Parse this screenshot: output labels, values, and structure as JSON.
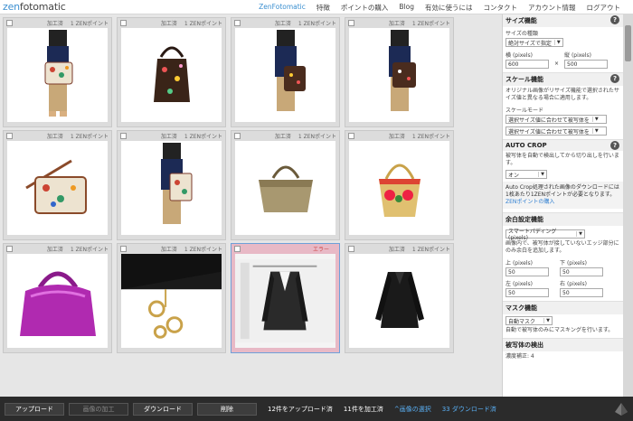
{
  "app": {
    "logo_prefix": "zen",
    "logo_suffix": "fotomatic"
  },
  "nav": [
    {
      "label": "ZenFotomatic",
      "active": true
    },
    {
      "label": "特徴",
      "active": false
    },
    {
      "label": "ポイントの購入",
      "active": false
    },
    {
      "label": "Blog",
      "active": false
    },
    {
      "label": "有効に使うには",
      "active": false
    },
    {
      "label": "コンタクト",
      "active": false
    },
    {
      "label": "アカウント情報",
      "active": false
    },
    {
      "label": "ログアウト",
      "active": false
    }
  ],
  "cards": [
    {
      "status": "加工済",
      "points": "1 ZENポイント",
      "image": "person-with-floral-bag"
    },
    {
      "status": "加工済",
      "points": "1 ZENポイント",
      "image": "dark-floral-tote"
    },
    {
      "status": "加工済",
      "points": "1 ZENポイント",
      "image": "person-with-brown-bag"
    },
    {
      "status": "加工済",
      "points": "1 ZENポイント",
      "image": "person-with-bag-back"
    },
    {
      "status": "加工済",
      "points": "1 ZENポイント",
      "image": "floral-shoulder-bag"
    },
    {
      "status": "加工済",
      "points": "1 ZENポイント",
      "image": "person-floral-tote"
    },
    {
      "status": "加工済",
      "points": "1 ZENポイント",
      "image": "khaki-tote"
    },
    {
      "status": "加工済",
      "points": "1 ZENポイント",
      "image": "straw-basket-bag"
    },
    {
      "status": "加工済",
      "points": "1 ZENポイント",
      "image": "purple-leather-bag"
    },
    {
      "status": "加工済",
      "points": "1 ZENポイント",
      "image": "bag-gold-charm"
    },
    {
      "status": "エラー",
      "points": "",
      "image": "black-suit-jacket",
      "selected": true
    },
    {
      "status": "加工済",
      "points": "1 ZENポイント",
      "image": "black-jacket"
    }
  ],
  "panel": {
    "size": {
      "title": "サイズ機能",
      "type_label": "サイズの種類",
      "type_value": "絶対サイズで指定",
      "w_label": "横",
      "h_label": "縦",
      "unit": "(pixels)",
      "w_value": "600",
      "h_value": "500",
      "x": "×"
    },
    "scale": {
      "title": "スケール機能",
      "desc": "オリジナル画像がリサイズ機能で選択されたサイズ値と異なる場合に適用します。",
      "mode_label": "スケールモード",
      "mode1": "選択サイズ値に合わせて被写体を",
      "mode2": "選択サイズ値に合わせて被写体を"
    },
    "autocrop": {
      "title": "AUTO CROP",
      "desc": "被写体を自動で検出してから切り出しを行います。",
      "value": "オン",
      "info": "Auto Crop処理された画像のダウンロードには1枚あたり1ZENポイントが必要となります。",
      "info_link": "ZENポイントの購入"
    },
    "margin": {
      "title": "余白設定機能",
      "value": "スマートパディング (pixels)",
      "desc": "画像内で、被写体が接していないエッジ部分にのみ余白を追加します。",
      "top_label": "上",
      "bottom_label": "下",
      "left_label": "左",
      "right_label": "右",
      "unit": "(pixels)",
      "top": "50",
      "bottom": "50",
      "left": "50",
      "right": "50"
    },
    "mask": {
      "title": "マスク機能",
      "value": "自動マスク",
      "desc": "自動で被写体のみにマスキングを行います。"
    },
    "detect": {
      "title": "被写体の検出",
      "value": "濃度補正: 4"
    }
  },
  "bottom": {
    "upload": "アップロード",
    "process": "画像の加工",
    "download": "ダウンロード",
    "delete": "削除",
    "uploaded": "12件をアップロード済",
    "processed": "11件を加工済",
    "select": "^画像の選択",
    "downloads": "33 ダウンロード済"
  },
  "icons": {
    "help": "help-icon",
    "dropdown": "chevron-down-icon",
    "corner": "app-logo-icon"
  }
}
